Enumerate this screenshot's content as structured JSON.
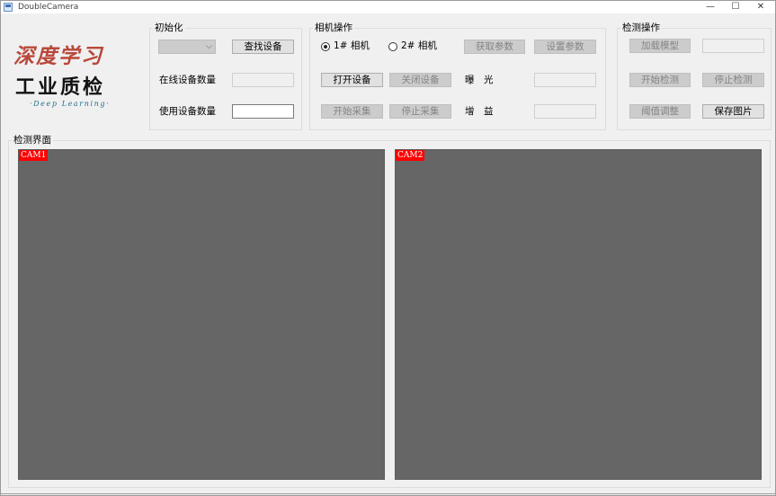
{
  "window": {
    "title": "DoubleCamera",
    "minimize_glyph": "—",
    "maximize_glyph": "☐",
    "close_glyph": "✕"
  },
  "logo": {
    "line1": "深度学习",
    "line2": "工业质检",
    "line3": "·Deep Learning·"
  },
  "init_group": {
    "label": "初始化",
    "combo_value": "",
    "find_button": "查找设备",
    "online_count_label": "在线设备数量",
    "online_count_value": "",
    "use_count_label": "使用设备数量",
    "use_count_value": ""
  },
  "camera_group": {
    "label": "相机操作",
    "radio1": "1# 相机",
    "radio2": "2# 相机",
    "get_params": "获取参数",
    "set_params": "设置参数",
    "open_device": "打开设备",
    "close_device": "关闭设备",
    "exposure_label": "曝　光",
    "exposure_value": "",
    "start_grab": "开始采集",
    "stop_grab": "停止采集",
    "gain_label": "增　益",
    "gain_value": ""
  },
  "detect_group": {
    "label": "检测操作",
    "load_model": "加载模型",
    "model_value": "",
    "start_detect": "开始检测",
    "stop_detect": "停止检测",
    "threshold": "阈值调整",
    "save_image": "保存图片"
  },
  "view_group": {
    "label": "检测界面",
    "cam1_tag": "CAM1",
    "cam2_tag": "CAM2"
  },
  "colors": {
    "camera_background": "#666666",
    "cam_tag_background": "#ff0000",
    "logo_red": "#b8483a",
    "logo_teal": "#1f6e8c"
  }
}
